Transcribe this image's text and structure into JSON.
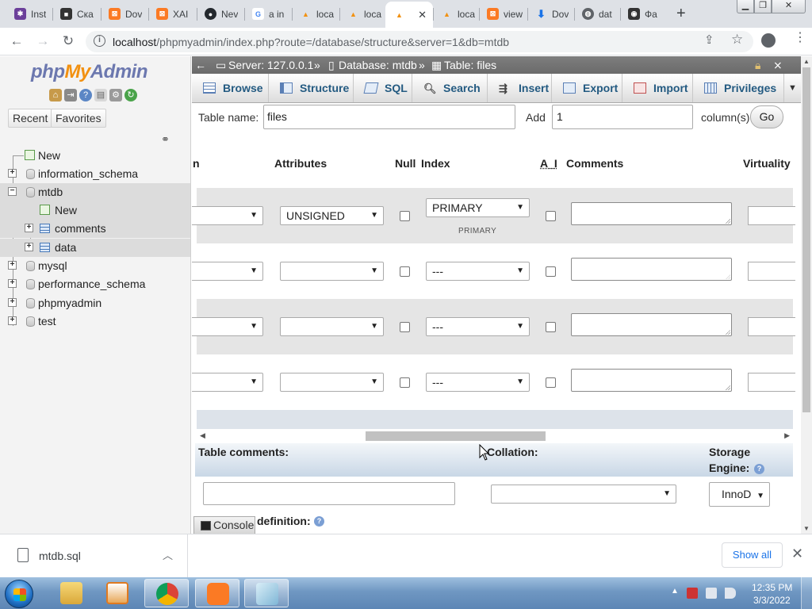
{
  "browser": {
    "tabs": [
      {
        "title": "Inst",
        "icon": "slack-icon",
        "color": "#6b3f9a"
      },
      {
        "title": "Ска",
        "icon": "video-icon",
        "color": "#333333"
      },
      {
        "title": "Dov",
        "icon": "xampp-icon",
        "color": "#fb7a24"
      },
      {
        "title": "XAI",
        "icon": "xampp-icon",
        "color": "#fb7a24"
      },
      {
        "title": "Nev",
        "icon": "github-icon",
        "color": "#24292e"
      },
      {
        "title": "a in",
        "icon": "google-icon",
        "color": "#4285f4"
      },
      {
        "title": "loca",
        "icon": "phpmyadmin-icon",
        "color": "#f29111"
      },
      {
        "title": "loca",
        "icon": "phpmyadmin-icon",
        "color": "#f29111"
      },
      {
        "title": "",
        "icon": "phpmyadmin-icon",
        "color": "#f29111"
      },
      {
        "title": "loca",
        "icon": "phpmyadmin-icon",
        "color": "#f29111"
      },
      {
        "title": "view",
        "icon": "xampp-icon",
        "color": "#fb7a24"
      },
      {
        "title": "Dov",
        "icon": "download-icon",
        "color": "#1a73e8"
      },
      {
        "title": "dat",
        "icon": "globe-icon",
        "color": "#5f6368"
      },
      {
        "title": "Фа",
        "icon": "eye-icon",
        "color": "#333333"
      }
    ],
    "url_host": "localhost",
    "url_path": "/phpmyadmin/index.php?route=/database/structure&server=1&db=mtdb"
  },
  "nav": {
    "logo_php": "php",
    "logo_my": "My",
    "logo_admin": "Admin",
    "recent_label": "Recent",
    "favorites_label": "Favorites",
    "tree": {
      "new": "New",
      "information_schema": "information_schema",
      "mtdb": "mtdb",
      "mtdb_new": "New",
      "comments": "comments",
      "data": "data",
      "mysql": "mysql",
      "performance_schema": "performance_schema",
      "phpmyadmin": "phpmyadmin",
      "test": "test"
    }
  },
  "main": {
    "breadcrumb": {
      "server": "Server: 127.0.0.1",
      "database": "Database: mtdb",
      "table": "Table: files",
      "sep": "»"
    },
    "tabs": {
      "browse": "Browse",
      "structure": "Structure",
      "sql": "SQL",
      "search": "Search",
      "insert": "Insert",
      "export": "Export",
      "import": "Import",
      "privileges": "Privileges"
    },
    "table_name_label": "Table name:",
    "table_name_value": "files",
    "add_label": "Add",
    "add_count": "1",
    "columns_label": "column(s)",
    "go_label": "Go",
    "headers": {
      "name": "n",
      "attributes": "Attributes",
      "null": "Null",
      "index": "Index",
      "ai": "A_I",
      "comments": "Comments",
      "virtuality": "Virtuality"
    },
    "rows": [
      {
        "attribute": "UNSIGNED",
        "index": "PRIMARY",
        "index_note": "PRIMARY"
      },
      {
        "attribute": "",
        "index": "---",
        "index_note": ""
      },
      {
        "attribute": "",
        "index": "---",
        "index_note": ""
      },
      {
        "attribute": "",
        "index": "---",
        "index_note": ""
      }
    ],
    "table_comments_label": "Table comments:",
    "collation_label": "Collation:",
    "storage_engine_label_1": "Storage",
    "storage_engine_label_2": "Engine:",
    "storage_engine_value": "InnoD",
    "partition_label": "definition:",
    "console_label": "Console"
  },
  "downloads": {
    "filename": "mtdb.sql",
    "show_all": "Show all"
  },
  "taskbar": {
    "time": "12:35 PM",
    "date": "3/3/2022"
  }
}
